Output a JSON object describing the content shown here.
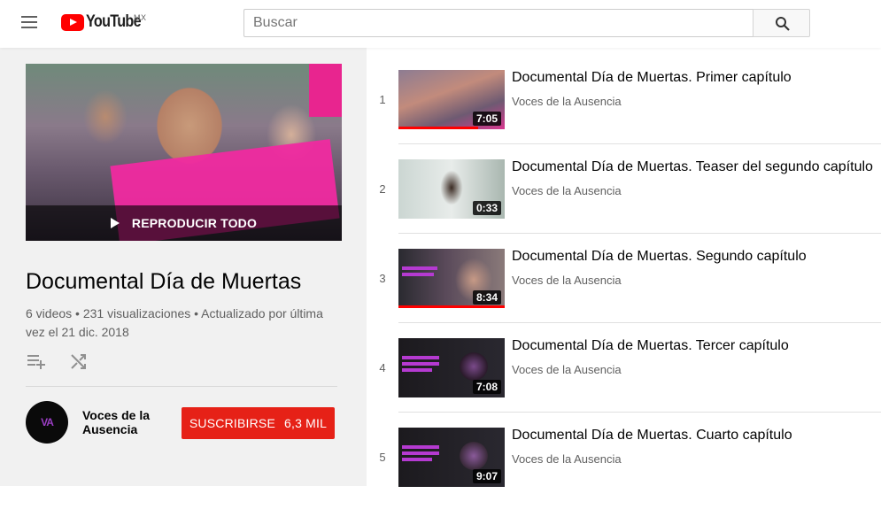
{
  "header": {
    "logo_text": "YouTube",
    "country": "MX",
    "search_placeholder": "Buscar"
  },
  "playlist": {
    "play_all_label": "REPRODUCIR TODO",
    "title": "Documental Día de Muertas",
    "stats": "6 videos • 231 visualizaciones • Actualizado por última vez el 21 dic. 2018"
  },
  "owner": {
    "avatar_text": "VA",
    "name": "Voces de la Ausencia",
    "subscribe_label": "SUSCRIBIRSE",
    "subscriber_count": "6,3 MIL"
  },
  "videos": [
    {
      "index": "1",
      "title": "Documental Día de Muertas. Primer capítulo",
      "channel": "Voces de la Ausencia",
      "duration": "7:05",
      "watched": 0.75
    },
    {
      "index": "2",
      "title": "Documental Día de Muertas. Teaser del segundo capítulo",
      "channel": "Voces de la Ausencia",
      "duration": "0:33",
      "watched": 0
    },
    {
      "index": "3",
      "title": "Documental Día de Muertas. Segundo capítulo",
      "channel": "Voces de la Ausencia",
      "duration": "8:34",
      "watched": 1
    },
    {
      "index": "4",
      "title": "Documental Día de Muertas. Tercer capítulo",
      "channel": "Voces de la Ausencia",
      "duration": "7:08",
      "watched": 0
    },
    {
      "index": "5",
      "title": "Documental Día de Muertas. Cuarto capítulo",
      "channel": "Voces de la Ausencia",
      "duration": "9:07",
      "watched": 0
    }
  ],
  "colors": {
    "subscribe": "#e62117",
    "progress": "#ff0000",
    "brand": "#ff0000"
  },
  "icons": [
    "menu-icon",
    "youtube-logo-icon",
    "search-icon",
    "play-icon",
    "add-to-queue-icon",
    "shuffle-icon"
  ]
}
